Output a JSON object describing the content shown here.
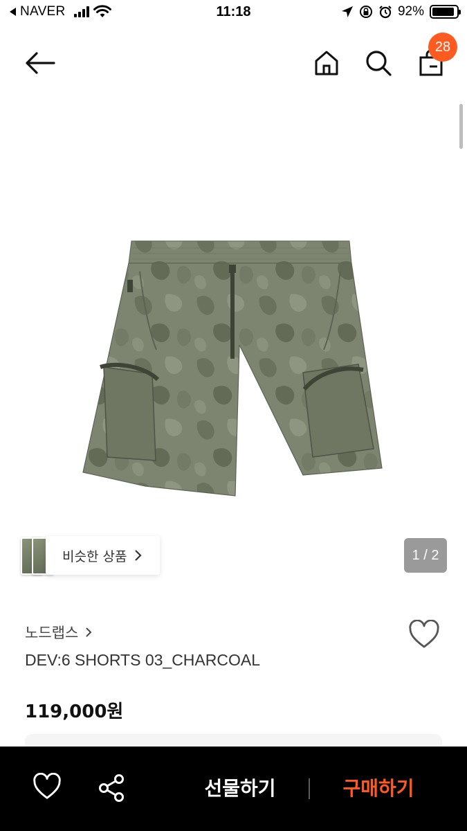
{
  "status_bar": {
    "carrier": "NAVER",
    "time": "11:18",
    "battery": "92%",
    "battery_level": 0.92
  },
  "header": {
    "back_icon": "arrow-left-icon",
    "home_icon": "home-icon",
    "search_icon": "search-icon",
    "cart_icon": "shopping-bag-icon",
    "cart_count": "28"
  },
  "gallery": {
    "similar_label": "비슷한 상품",
    "page_indicator": "1 / 2"
  },
  "product": {
    "brand": "노드랩스",
    "name": "DEV:6 SHORTS 03_CHARCOAL",
    "price": "119,000원"
  },
  "bottom_bar": {
    "wishlist_icon": "heart-outline-icon",
    "share_icon": "share-icon",
    "gift_label": "선물하기",
    "buy_label": "구매하기"
  },
  "colors": {
    "accent": "#ff5a1f",
    "bottom_bar_bg": "#000000",
    "page_indicator_bg": "#9a9a9a"
  }
}
